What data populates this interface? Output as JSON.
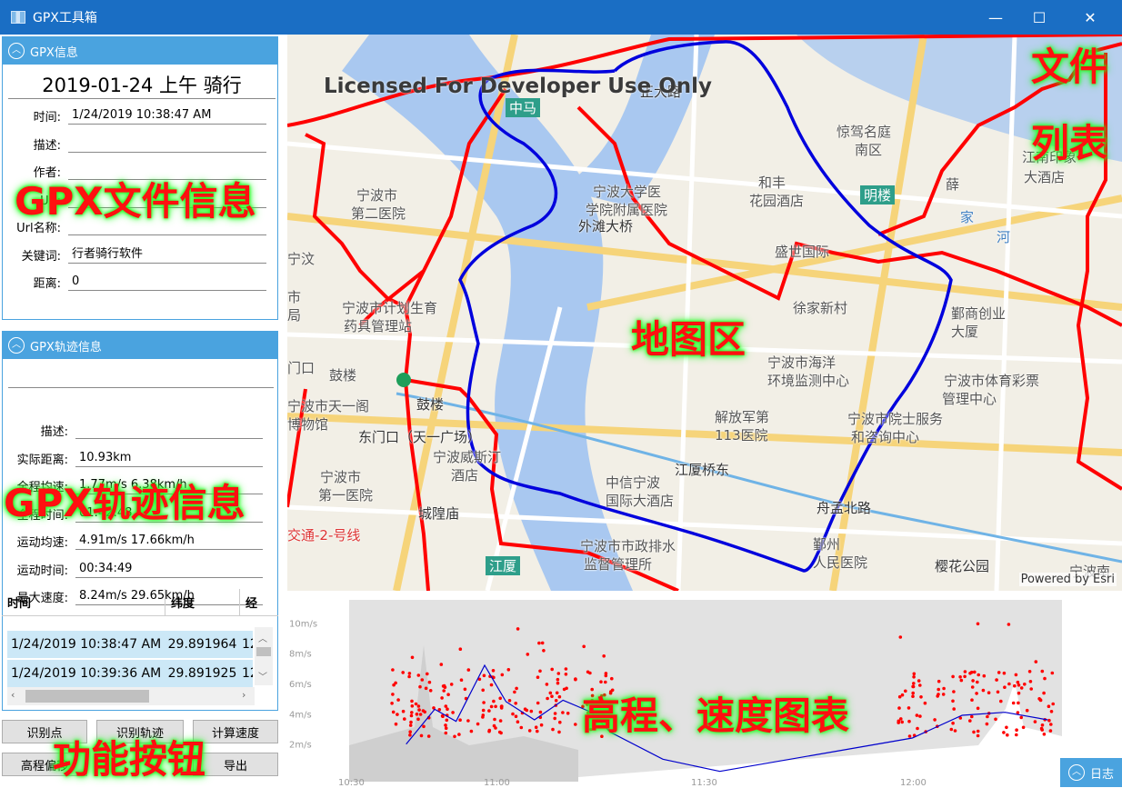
{
  "window": {
    "title": "GPX工具箱",
    "minimize": "—",
    "maximize": "☐",
    "close": "✕"
  },
  "gpx_info": {
    "header": "GPX信息",
    "title": "2019-01-24 上午 骑行",
    "fields": [
      {
        "label": "时间:",
        "value": "1/24/2019 10:38:47 AM"
      },
      {
        "label": "描述:",
        "value": ""
      },
      {
        "label": "作者:",
        "value": ""
      },
      {
        "label": "Url:",
        "value": ""
      },
      {
        "label": "Url名称:",
        "value": ""
      },
      {
        "label": "关键词:",
        "value": "行者骑行软件"
      },
      {
        "label": "距离:",
        "value": "0"
      }
    ]
  },
  "track_info": {
    "header": "GPX轨迹信息",
    "name": "",
    "fields": [
      {
        "label": "描述:",
        "value": ""
      },
      {
        "label": "实际距离:",
        "value": "10.93km"
      },
      {
        "label": "全程均速:",
        "value": "1.77m/s    6.38km/h"
      },
      {
        "label": "全程时间:",
        "value": "01:42:48"
      },
      {
        "label": "运动均速:",
        "value": "4.91m/s    17.66km/h"
      },
      {
        "label": "运动时间:",
        "value": "00:34:49"
      },
      {
        "label": "最大速度:",
        "value": "8.24m/s    29.65km/h"
      }
    ]
  },
  "points_table": {
    "headers": [
      "时间",
      "纬度",
      "经"
    ],
    "rows": [
      [
        "1/24/2019 10:38:47 AM",
        "29.891964",
        "12"
      ],
      [
        "1/24/2019 10:39:36 AM",
        "29.891925",
        "12"
      ]
    ]
  },
  "buttons": {
    "identify_points": "识别点",
    "identify_track": "识别轨迹",
    "calc_speed": "计算速度",
    "elevation_offset": "高程偏移",
    "export": "导出"
  },
  "overlay_labels": {
    "file_info": "GPX文件信息",
    "track_info": "GPX轨迹信息",
    "function_buttons": "功能按钮",
    "map_area": "地图区",
    "file_list_1": "文件",
    "file_list_2": "列表",
    "chart_area": "高程、速度图表"
  },
  "map": {
    "watermark": "Licensed For Developer Use Only",
    "attribution": "Powered by Esri",
    "labels": [
      {
        "text": "中马",
        "kind": "metro"
      },
      {
        "text": "正大路",
        "kind": "road"
      },
      {
        "text": "惊驾名庭",
        "kind": "place"
      },
      {
        "text": "南区",
        "kind": "place"
      },
      {
        "text": "江南印象",
        "kind": "place"
      },
      {
        "text": "大酒店",
        "kind": "place"
      },
      {
        "text": "宁波市",
        "kind": "place"
      },
      {
        "text": "第二医院",
        "kind": "place"
      },
      {
        "text": "宁波大学医",
        "kind": "place"
      },
      {
        "text": "学院附属医院",
        "kind": "place"
      },
      {
        "text": "和丰",
        "kind": "place"
      },
      {
        "text": "花园酒店",
        "kind": "place"
      },
      {
        "text": "明楼",
        "kind": "metro"
      },
      {
        "text": "外滩大桥",
        "kind": "road"
      },
      {
        "text": "家",
        "kind": "water"
      },
      {
        "text": "河",
        "kind": "water"
      },
      {
        "text": "盛世国际",
        "kind": "place"
      },
      {
        "text": "宁波市计划生育",
        "kind": "place"
      },
      {
        "text": "药具管理站",
        "kind": "place"
      },
      {
        "text": "徐家新村",
        "kind": "place"
      },
      {
        "text": "鄞商创业",
        "kind": "place"
      },
      {
        "text": "大厦",
        "kind": "place"
      },
      {
        "text": "鼓楼",
        "kind": "place"
      },
      {
        "text": "宁波市海洋",
        "kind": "place"
      },
      {
        "text": "环境监测中心",
        "kind": "place"
      },
      {
        "text": "宁波市体育彩票",
        "kind": "place"
      },
      {
        "text": "管理中心",
        "kind": "place"
      },
      {
        "text": "宁波市天一阁",
        "kind": "place"
      },
      {
        "text": "博物馆",
        "kind": "place"
      },
      {
        "text": "鼓楼",
        "kind": "road"
      },
      {
        "text": "解放军第",
        "kind": "place"
      },
      {
        "text": "113医院",
        "kind": "place"
      },
      {
        "text": "宁波市院士服务",
        "kind": "place"
      },
      {
        "text": "和咨询中心",
        "kind": "place"
      },
      {
        "text": "东门口（天一广场）",
        "kind": "road"
      },
      {
        "text": "宁波威斯汀",
        "kind": "place"
      },
      {
        "text": "酒店",
        "kind": "place"
      },
      {
        "text": "江厦桥东",
        "kind": "road"
      },
      {
        "text": "中信宁波",
        "kind": "place"
      },
      {
        "text": "国际大酒店",
        "kind": "place"
      },
      {
        "text": "宁波市",
        "kind": "place"
      },
      {
        "text": "第一医院",
        "kind": "place"
      },
      {
        "text": "城隍庙",
        "kind": "road"
      },
      {
        "text": "舟孟北路",
        "kind": "road"
      },
      {
        "text": "交通-2-号线",
        "kind": "metro-line"
      },
      {
        "text": "宁波市市政排水",
        "kind": "place"
      },
      {
        "text": "监督管理所",
        "kind": "place"
      },
      {
        "text": "鄞州",
        "kind": "place"
      },
      {
        "text": "人民医院",
        "kind": "place"
      },
      {
        "text": "樱花公园",
        "kind": "road"
      },
      {
        "text": "宁波南",
        "kind": "place"
      },
      {
        "text": "江厦",
        "kind": "metro"
      },
      {
        "text": "门口",
        "kind": "place"
      },
      {
        "text": "市",
        "kind": "place"
      },
      {
        "text": "局",
        "kind": "place"
      },
      {
        "text": "宁汶",
        "kind": "place"
      },
      {
        "text": "薛",
        "kind": "place"
      }
    ]
  },
  "chart_data": {
    "type": "line",
    "title": "",
    "xlabel": "",
    "ylabel": "",
    "x_ticks": [
      "10:30",
      "11:00",
      "11:30",
      "12:00"
    ],
    "y_ticks": [
      "2m/s",
      "4m/s",
      "6m/s",
      "8m/s",
      "10m/s"
    ],
    "ylim": [
      0,
      10
    ],
    "colors": {
      "speed_points": "#ff0000",
      "speed_line": "#0000cc",
      "elevation": "#d9d9d9"
    },
    "series": [
      {
        "values_min_speed": [
          [
            10.4,
            2.0
          ],
          [
            10.6,
            4.3
          ],
          [
            10.75,
            3.5
          ],
          [
            10.95,
            7.2
          ],
          [
            11.1,
            4.8
          ],
          [
            11.3,
            3.6
          ],
          [
            11.5,
            4.9
          ],
          [
            11.7,
            4.1
          ],
          [
            11.83,
            2.8
          ],
          [
            12.2,
            1.0
          ],
          [
            12.6,
            0.2
          ],
          [
            13.4,
            1.5
          ],
          [
            13.95,
            2.4
          ],
          [
            14.3,
            3.9
          ],
          [
            14.6,
            4.1
          ],
          [
            14.9,
            3.6
          ]
        ]
      }
    ]
  },
  "log_button": "日志"
}
